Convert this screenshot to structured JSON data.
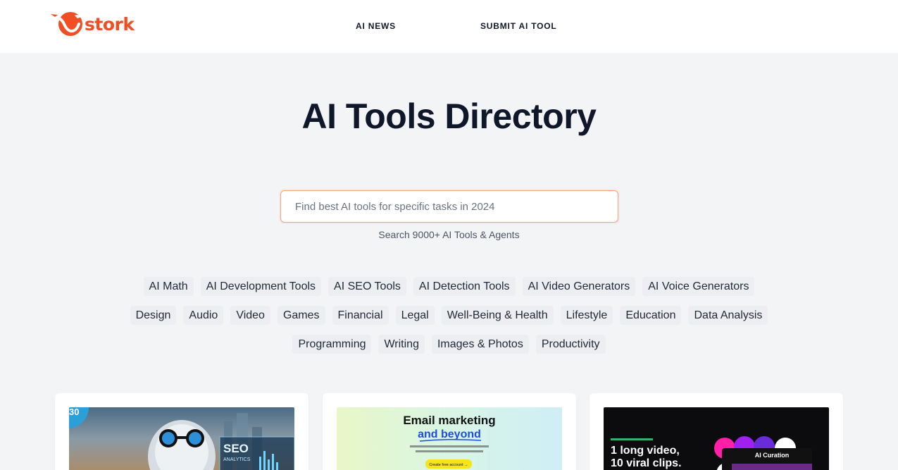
{
  "header": {
    "logo_text": "stork",
    "nav": [
      "AI NEWS",
      "SUBMIT AI TOOL"
    ]
  },
  "hero": {
    "title": "AI Tools Directory",
    "search_placeholder": "Find best AI tools for specific tasks in 2024",
    "search_subtext": "Search 9000+ AI Tools & Agents"
  },
  "tags": {
    "row1": [
      "AI Math",
      "AI Development Tools",
      "AI SEO Tools",
      "AI Detection Tools",
      "AI Video Generators",
      "AI Voice Generators"
    ],
    "row2": [
      "Design",
      "Audio",
      "Video",
      "Games",
      "Financial",
      "Legal",
      "Well-Being & Health",
      "Lifestyle",
      "Education",
      "Data Analysis"
    ],
    "row3": [
      "Programming",
      "Writing",
      "Images & Photos",
      "Productivity"
    ]
  },
  "cards": [
    {
      "image_texts": [
        "30",
        "SEO",
        "ANALYTICS"
      ]
    },
    {
      "image_texts": [
        "Email marketing",
        "and beyond",
        "Create free account →"
      ]
    },
    {
      "image_texts": [
        "1 long video,",
        "10 viral clips.",
        "AI Curation"
      ]
    }
  ],
  "colors": {
    "brand": "#f04e23",
    "background": "#f3f4f6",
    "search_border": "#f4a47c"
  }
}
